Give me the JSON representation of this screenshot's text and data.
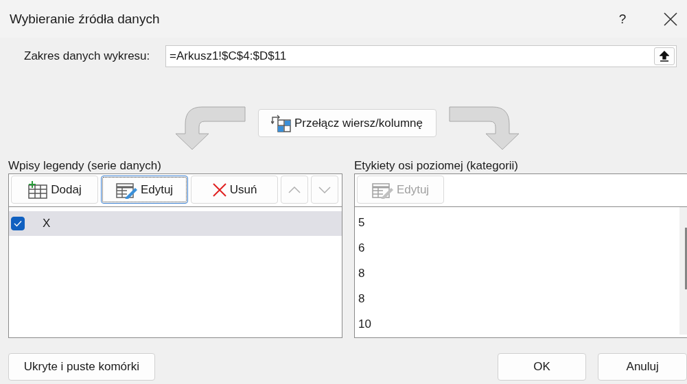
{
  "window": {
    "title": "Wybieranie źródła danych",
    "help": "?"
  },
  "range": {
    "label": "Zakres danych wykresu:",
    "value": "=Arkusz1!$C$4:$D$11"
  },
  "switch_button": "Przełącz wiersz/kolumnę",
  "legend": {
    "label": "Wpisy legendy (serie danych)",
    "buttons": [
      {
        "kind": "add",
        "label": "Dodaj",
        "focused": false,
        "disabled": false
      },
      {
        "kind": "edit",
        "label": "Edytuj",
        "focused": true,
        "disabled": false
      },
      {
        "kind": "remove",
        "label": "Usuń",
        "focused": false,
        "disabled": false
      },
      {
        "kind": "up",
        "focused": false,
        "disabled": true
      },
      {
        "kind": "down",
        "focused": false,
        "disabled": true
      }
    ],
    "series": [
      {
        "name": "X",
        "checked": true,
        "selected": true
      }
    ]
  },
  "categories": {
    "label": "Etykiety osi poziomej (kategorii)",
    "edit_button": {
      "label": "Edytuj",
      "disabled": true
    },
    "items": [
      "5",
      "6",
      "8",
      "8",
      "10"
    ]
  },
  "hidden_cells_button": "Ukryte i puste komórki",
  "buttons": [
    "OK",
    "Anuluj"
  ]
}
